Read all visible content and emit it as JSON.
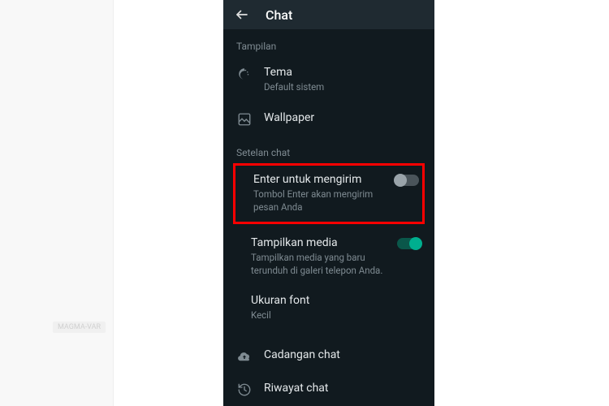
{
  "header": {
    "title": "Chat"
  },
  "sections": {
    "tampilan": {
      "label": "Tampilan",
      "tema": {
        "title": "Tema",
        "sub": "Default sistem"
      },
      "wallpaper": {
        "title": "Wallpaper"
      }
    },
    "setelan": {
      "label": "Setelan chat",
      "enter": {
        "title": "Enter untuk mengirim",
        "sub": "Tombol Enter akan mengirim pesan Anda",
        "enabled": false
      },
      "media": {
        "title": "Tampilkan media",
        "sub": "Tampilkan media yang baru terunduh di galeri telepon Anda.",
        "enabled": true
      },
      "font": {
        "title": "Ukuran font",
        "sub": "Kecil"
      }
    },
    "footer": {
      "cadangan": {
        "title": "Cadangan chat"
      },
      "riwayat": {
        "title": "Riwayat chat"
      }
    }
  },
  "bg": {
    "tag": "MAGMA-VAR"
  }
}
